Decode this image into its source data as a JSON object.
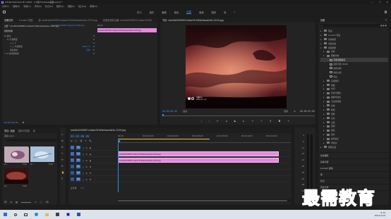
{
  "colors": {
    "accent": "#4a90e2",
    "clip": "#e58ae0",
    "selected_clip": "#d36be0",
    "playhead": "#2d8ceb",
    "watermark": "#1550b4"
  },
  "titlebar": {
    "title": "Adobe Premiere Pro 2020 - C:\\用户\\Videos\\画面.prproj *",
    "controls": [
      "—",
      "☐",
      "✕"
    ]
  },
  "menubar": [
    "文件(F)",
    "编辑(E)",
    "剪辑(C)",
    "序列(S)",
    "标记(M)",
    "图形(G)",
    "视图(V)",
    "窗口(W)",
    "帮助(H)"
  ],
  "workspaces": [
    "学习",
    "组件",
    "编辑",
    "颜色",
    "效果",
    "音频",
    "图形",
    "库"
  ],
  "active_workspace": "效果",
  "effect_controls": {
    "tabs": [
      "效果控件",
      "Lumetri 范围",
      "源: shelf4d2f4f9f07c4abe7b7b0b3aea4b3e-2229.jpg",
      "音频剪辑混合器: shelf4d2f4f9f07c4abe7b7b0"
    ],
    "source_line": "主要 * shelf4d2f4f9f07c4abe7b7b0b3aea4b3e-2229.jpg",
    "sequence_line": "shelf4d2f4f9f07c4abe7b7b0b3ae…",
    "timecode_small": "00:00",
    "clip_name": "shelf4d2f4f9f07c4abe7b7b0b3aea4b3e-2229.jpg",
    "section_video": "视频效果",
    "rows": [
      {
        "label": "fx  运动",
        "indent": 0
      },
      {
        "label": "fx  不透明度",
        "indent": 1
      },
      {
        "label": "○ □ ✐",
        "indent": 2
      },
      {
        "label": "> ○ 不透明度",
        "indent": 2,
        "value": "100.0 %"
      },
      {
        "label": "混合模式",
        "indent": 2,
        "value": "正常"
      },
      {
        "label": "> fx  时间重映射",
        "indent": 0
      }
    ],
    "bottom_time": "00:00:00:00"
  },
  "program": {
    "tab": "节目: shelf4d2f4f9f07c4abe7b7b0b3aea4b3e-2229.jpg",
    "timecode_left": "00:00:00:00",
    "fit": "适合",
    "quality": "完整",
    "timecode_right": "00:00:05:00",
    "overlay_line1": "宝藏中心",
    "overlay_line2": "WWW.XX.COM"
  },
  "project": {
    "tabs": [
      "项目: 画面",
      "媒体浏览器",
      "库"
    ],
    "path": "画面.prproj",
    "search_placeholder": "",
    "thumbs": [
      {
        "label": "sh…",
        "duration": "5:00"
      },
      {
        "label": "sh…",
        "duration": "5:00"
      },
      {
        "label": "sh…",
        "duration": "5:00"
      }
    ]
  },
  "timeline": {
    "tab": "shelf4d2f4f9f07c4abe7b7b0b3aea4b3e-2229.jpg",
    "timecode": "00:00:00:00",
    "ruler": [
      "00:00",
      "00:00:02:00",
      "00:00:04:00",
      "00:00:06:00",
      "00:00:08:00",
      "00:00:10:00",
      "00:00:12:00"
    ],
    "tracks": [
      {
        "name": "V3"
      },
      {
        "name": "V2"
      },
      {
        "name": "V1"
      },
      {
        "name": "A1"
      },
      {
        "name": "A2"
      },
      {
        "name": "A3"
      }
    ],
    "master": "主声道",
    "master_value": "0.0",
    "clips": [
      {
        "track": "V2",
        "label": "shelf4d2f4f9f07c4abe7b7b0b3aea4b3e-2229.jpg",
        "start": 0,
        "end": 5
      },
      {
        "track": "V1",
        "label": "shelf4d2f4f9f07c4abe7b7b0b3aea4b3e-2229.jpg",
        "start": 0,
        "end": 5
      }
    ]
  },
  "meter": {
    "db_labels": [
      "0",
      "-6",
      "-12",
      "-18",
      "-24",
      "-30",
      "-36",
      "-42",
      "-48",
      "-54"
    ],
    "footer": "S S"
  },
  "effects_panel": {
    "title": "效果",
    "search_placeholder": "",
    "items": [
      {
        "label": "预设",
        "depth": 0,
        "kind": "folder"
      },
      {
        "label": "Lumetri 预设",
        "depth": 0,
        "kind": "folder"
      },
      {
        "label": "音频效果",
        "depth": 0,
        "kind": "folder"
      },
      {
        "label": "音频过渡",
        "depth": 0,
        "kind": "folder"
      },
      {
        "label": "视频效果",
        "depth": 0,
        "kind": "folder-open"
      },
      {
        "label": "变换",
        "depth": 1,
        "kind": "folder"
      },
      {
        "label": "图像控制",
        "depth": 1,
        "kind": "folder-open"
      },
      {
        "label": "灰度系数校正",
        "depth": 2,
        "kind": "fx",
        "selected": true
      },
      {
        "label": "颜色平衡 (RGB)",
        "depth": 2,
        "kind": "fx"
      },
      {
        "label": "颜色替换",
        "depth": 2,
        "kind": "fx"
      },
      {
        "label": "颜色过滤",
        "depth": 2,
        "kind": "fx"
      },
      {
        "label": "黑白",
        "depth": 2,
        "kind": "fx"
      },
      {
        "label": "实用程序",
        "depth": 1,
        "kind": "folder"
      },
      {
        "label": "扭曲",
        "depth": 1,
        "kind": "folder"
      },
      {
        "label": "时间",
        "depth": 1,
        "kind": "folder"
      },
      {
        "label": "杂色与颗粒",
        "depth": 1,
        "kind": "folder"
      },
      {
        "label": "模糊与锐化",
        "depth": 1,
        "kind": "folder"
      },
      {
        "label": "沉浸式视频",
        "depth": 1,
        "kind": "folder"
      },
      {
        "label": "生成",
        "depth": 1,
        "kind": "folder"
      },
      {
        "label": "视频",
        "depth": 1,
        "kind": "folder"
      },
      {
        "label": "调整",
        "depth": 1,
        "kind": "folder"
      },
      {
        "label": "过时",
        "depth": 1,
        "kind": "folder"
      },
      {
        "label": "过渡",
        "depth": 1,
        "kind": "folder"
      },
      {
        "label": "透视",
        "depth": 1,
        "kind": "folder"
      },
      {
        "label": "通道",
        "depth": 1,
        "kind": "folder"
      },
      {
        "label": "键控",
        "depth": 1,
        "kind": "folder"
      },
      {
        "label": "颜色校正",
        "depth": 1,
        "kind": "folder"
      },
      {
        "label": "风格化",
        "depth": 1,
        "kind": "folder"
      },
      {
        "label": "视频过渡",
        "depth": 0,
        "kind": "folder"
      }
    ],
    "collapsed_sections": [
      "基本图形",
      "基本声音",
      "Lumetri 颜色",
      "库",
      "标记",
      "历史记录",
      "信息"
    ]
  },
  "watermark": "最需教育",
  "taskbar": {
    "time": "9:15",
    "date": "2021/11/9",
    "apps": [
      "windows-icon",
      "search-icon",
      "task-view-icon",
      "edge-icon",
      "explorer-icon",
      "store-icon",
      "premiere-icon",
      "word-icon"
    ]
  }
}
